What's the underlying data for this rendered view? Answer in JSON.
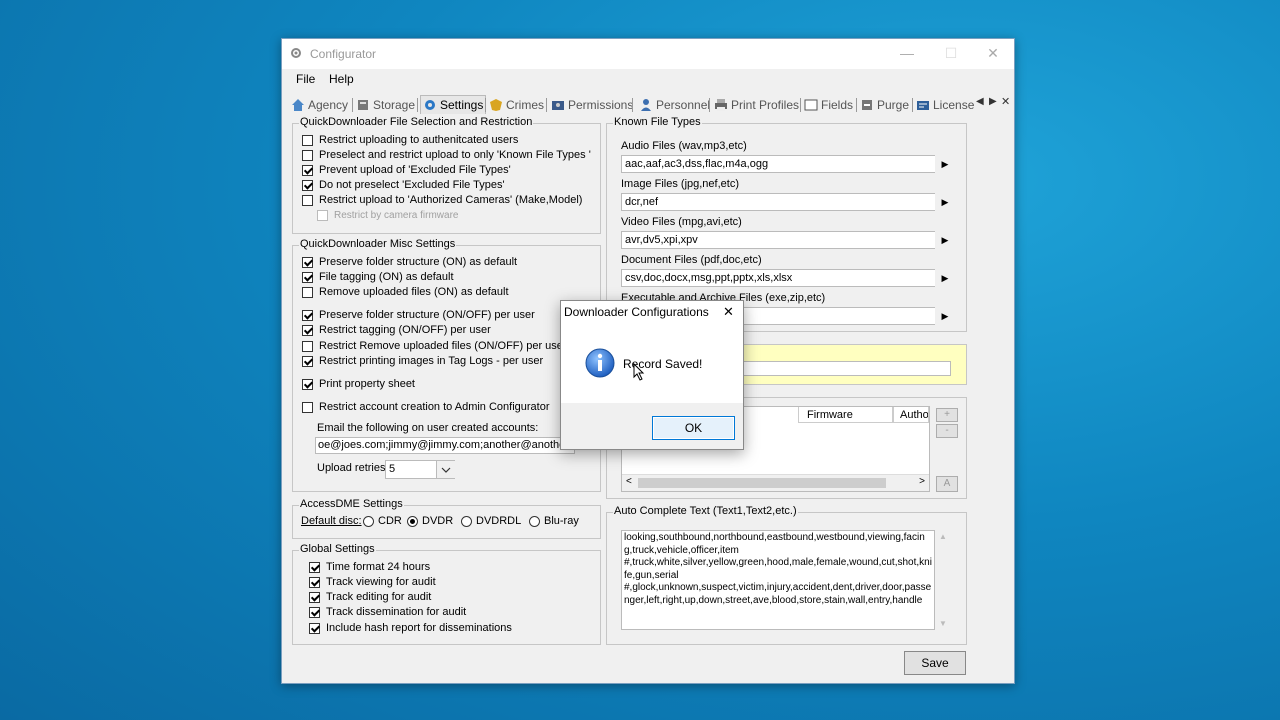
{
  "window": {
    "title": "Configurator",
    "minimize": "—",
    "maximize": "☐",
    "close": "✕"
  },
  "menu": {
    "file": "File",
    "help": "Help"
  },
  "tabs": [
    "Agency",
    "Storage",
    "Settings",
    "Crimes",
    "Permissions",
    "Personnel",
    "Print Profiles",
    "Fields",
    "Purge",
    "License"
  ],
  "tab_scroll": {
    "left": "◀",
    "right": "▶",
    "close": "✕"
  },
  "file_selection": {
    "title": "QuickDownloader File Selection and Restriction",
    "items": [
      {
        "label": "Restrict uploading to authenitcated users",
        "checked": false
      },
      {
        "label": "Preselect and restrict upload to only 'Known File Types '",
        "checked": false
      },
      {
        "label": "Prevent upload of 'Excluded File Types'",
        "checked": true
      },
      {
        "label": "Do not preselect 'Excluded File Types'",
        "checked": true
      },
      {
        "label": "Restrict upload to 'Authorized Cameras' (Make,Model)",
        "checked": false
      }
    ],
    "sub_item": {
      "label": "Restrict by camera firmware",
      "checked": false
    }
  },
  "misc_settings": {
    "title": "QuickDownloader Misc Settings",
    "items": [
      {
        "label": "Preserve folder structure (ON) as default",
        "checked": true
      },
      {
        "label": "File tagging (ON) as default",
        "checked": true
      },
      {
        "label": "Remove uploaded  files (ON) as default",
        "checked": false
      },
      {
        "label": "Preserve folder structure (ON/OFF) per user",
        "checked": true
      },
      {
        "label": "Restrict tagging (ON/OFF) per user",
        "checked": true
      },
      {
        "label": "Restrict Remove uploaded  files (ON/OFF) per user",
        "checked": false
      },
      {
        "label": "Restrict printing images in Tag Logs - per user",
        "checked": true
      },
      {
        "label": "Print property sheet",
        "checked": true
      },
      {
        "label": "Restrict account creation to Admin Configurator",
        "checked": false
      }
    ],
    "email_label": "Email the following on user created accounts:",
    "email_value": "oe@joes.com;jimmy@jimmy.com;another@another.c",
    "retries_label": "Upload retries:",
    "retries_value": "5"
  },
  "accessdme": {
    "title": "AccessDME Settings",
    "default_disc_label": "Default disc:",
    "options": [
      {
        "label": "CDR",
        "selected": false
      },
      {
        "label": "DVDR",
        "selected": true
      },
      {
        "label": "DVDRDL",
        "selected": false
      },
      {
        "label": "Blu-ray",
        "selected": false
      }
    ]
  },
  "global_settings": {
    "title": "Global Settings",
    "items": [
      {
        "label": "Time format 24 hours",
        "checked": true
      },
      {
        "label": "Track viewing for audit",
        "checked": true
      },
      {
        "label": "Track editing for audit",
        "checked": true
      },
      {
        "label": "Track dissemination for audit",
        "checked": true
      },
      {
        "label": "Include hash report for disseminations",
        "checked": true
      }
    ]
  },
  "known_file_types": {
    "title": "Known File Types",
    "entries": [
      {
        "label": "Audio Files (wav,mp3,etc)",
        "value": "aac,aaf,ac3,dss,flac,m4a,ogg"
      },
      {
        "label": "Image Files (jpg,nef,etc)",
        "value": "dcr,nef"
      },
      {
        "label": "Video Files (mpg,avi,etc)",
        "value": "avr,dv5,xpi,xpv"
      },
      {
        "label": "Document Files (pdf,doc,etc)",
        "value": "csv,doc,docx,msg,ppt,pptx,xls,xlsx"
      },
      {
        "label": "Executable and Archive Files (exe,zip,etc)",
        "value": ""
      }
    ]
  },
  "cameras_table": {
    "columns": [
      "Firmware",
      "Autho"
    ],
    "plus": "+",
    "minus": "-",
    "a_button": "A"
  },
  "auto_complete": {
    "title": "Auto Complete Text (Text1,Text2,etc.)",
    "text": "looking,southbound,northbound,eastbound,westbound,viewing,facing,truck,vehicle,officer,item\n#,truck,white,silver,yellow,green,hood,male,female,wound,cut,shot,knife,gun,serial\n#,glock,unknown,suspect,victim,injury,accident,dent,driver,door,passenger,left,right,up,down,street,ave,blood,store,stain,wall,entry,handle"
  },
  "save_label": "Save",
  "dialog": {
    "title": "Downloader Configurations",
    "message": "Record Saved!",
    "ok": "OK",
    "close": "✕",
    "icon": "info-icon"
  },
  "colors": {
    "desktop": "#0f86c0",
    "highlight": "#ffffc0",
    "info_icon": "#2a6fd0"
  }
}
